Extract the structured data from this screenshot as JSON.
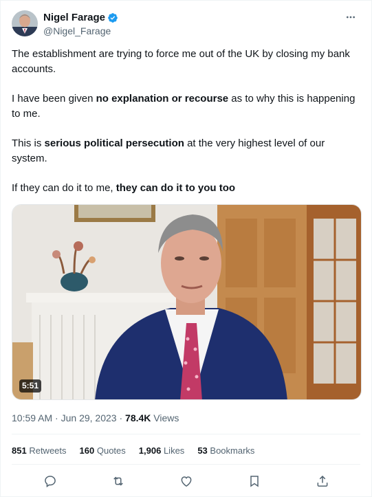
{
  "author": {
    "name": "Nigel Farage",
    "handle": "@Nigel_Farage",
    "verified": true
  },
  "tweet": {
    "p1": "The establishment are trying to force me out of the UK by closing my bank accounts.",
    "p2_before": "I have been given ",
    "p2_bold": "no explanation or recourse",
    "p2_after": " as to why this is happening to me.",
    "p3_before": "This is ",
    "p3_bold": "serious political persecution",
    "p3_after": " at the very highest level of our system.",
    "p4_before": "If they can do it to me, ",
    "p4_bold": "they can do it to you too"
  },
  "video": {
    "duration": "5:51"
  },
  "meta": {
    "time": "10:59 AM",
    "separator": " · ",
    "date": "Jun 29, 2023",
    "views_count": "78.4K",
    "views_label": " Views"
  },
  "stats": [
    {
      "count": "851",
      "label": "Retweets"
    },
    {
      "count": "160",
      "label": "Quotes"
    },
    {
      "count": "1,906",
      "label": "Likes"
    },
    {
      "count": "53",
      "label": "Bookmarks"
    }
  ],
  "actions": [
    "reply-icon",
    "retweet-icon",
    "like-icon",
    "bookmark-icon",
    "share-icon"
  ],
  "colors": {
    "verified": "#1d9bf0",
    "icon": "#536471",
    "text": "#0f1419"
  }
}
